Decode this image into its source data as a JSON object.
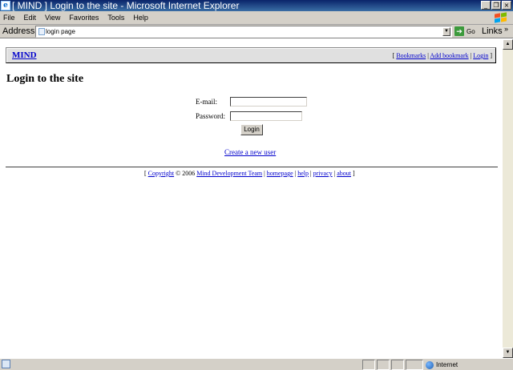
{
  "window": {
    "title": "[ MIND ] Login to the site - Microsoft Internet Explorer",
    "app_icon": "ie-icon",
    "buttons": [
      "minimize-icon",
      "restore-icon",
      "close-icon"
    ]
  },
  "menu": {
    "items": [
      "File",
      "Edit",
      "View",
      "Favorites",
      "Tools",
      "Help"
    ]
  },
  "address": {
    "label": "Address",
    "value": "login page",
    "go_label": "Go",
    "links_label": "Links",
    "links_chevron": "»"
  },
  "site": {
    "logo": "MIND",
    "nav": {
      "open": "[ ",
      "bookmarks": "Bookmarks",
      "sep1": " | ",
      "add_bookmark": "Add bookmark",
      "sep2": " | ",
      "login": "Login",
      "close": " ]"
    }
  },
  "page": {
    "title": "Login to the site"
  },
  "form": {
    "email_label": "E-mail:",
    "email_value": "",
    "password_label": "Password:",
    "password_value": "",
    "login_button": "Login",
    "create_user_link": "Create a new user"
  },
  "footer": {
    "open": "[ ",
    "copyright": "Copyright",
    "year_text": " © 2006 ",
    "team": "Mind Development Team",
    "sep1": " | ",
    "homepage": "homepage",
    "sep2": " | ",
    "help": "help",
    "sep3": " | ",
    "privacy": "privacy",
    "sep4": " | ",
    "about": "about",
    "close": " ]"
  },
  "status": {
    "zone": "Internet"
  },
  "colors": {
    "titlebar": "#0a246a",
    "chrome": "#d4d0c8",
    "link": "#0000cc"
  }
}
